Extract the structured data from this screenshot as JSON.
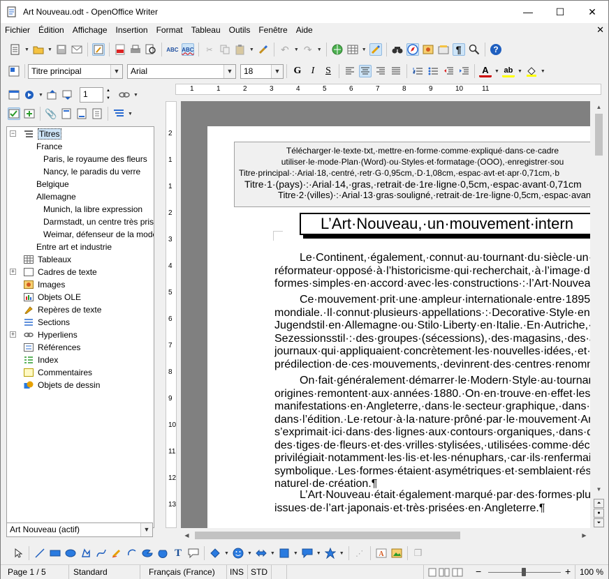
{
  "window": {
    "title": "Art Nouveau.odt - OpenOffice Writer",
    "minimize": "—",
    "maximize": "☐",
    "close": "✕"
  },
  "menu": [
    "Fichier",
    "Édition",
    "Affichage",
    "Insertion",
    "Format",
    "Tableau",
    "Outils",
    "Fenêtre",
    "Aide"
  ],
  "format_bar": {
    "style": "Titre principal",
    "font": "Arial",
    "size": "18"
  },
  "navigator": {
    "page_number": "1",
    "tree": [
      {
        "label": "Titres",
        "level": 0,
        "icon": "headings-icon",
        "selected": true
      },
      {
        "label": "France",
        "level": 1
      },
      {
        "label": "Paris, le royaume des fleurs",
        "level": 2
      },
      {
        "label": "Nancy, le paradis du verre",
        "level": 2
      },
      {
        "label": "Belgique",
        "level": 1
      },
      {
        "label": "Allemagne",
        "level": 1
      },
      {
        "label": "Munich, la libre expression",
        "level": 2
      },
      {
        "label": "Darmstadt, un centre très prisé",
        "level": 2
      },
      {
        "label": "Weimar, défenseur de la mode",
        "level": 2
      },
      {
        "label": "Entre art et industrie",
        "level": 1
      },
      {
        "label": "Tableaux",
        "level": 0,
        "icon": "table-icon"
      },
      {
        "label": "Cadres de texte",
        "level": 0,
        "icon": "frame-icon"
      },
      {
        "label": "Images",
        "level": 0,
        "icon": "image-icon"
      },
      {
        "label": "Objets OLE",
        "level": 0,
        "icon": "ole-object-icon"
      },
      {
        "label": "Repères de texte",
        "level": 0,
        "icon": "bookmark-icon"
      },
      {
        "label": "Sections",
        "level": 0,
        "icon": "section-icon"
      },
      {
        "label": "Hyperliens",
        "level": 0,
        "icon": "hyperlink-icon"
      },
      {
        "label": "Références",
        "level": 0,
        "icon": "reference-icon"
      },
      {
        "label": "Index",
        "level": 0,
        "icon": "index-icon"
      },
      {
        "label": "Commentaires",
        "level": 0,
        "icon": "comment-icon"
      },
      {
        "label": "Objets de dessin",
        "level": 0,
        "icon": "drawing-object-icon"
      }
    ],
    "document": "Art Nouveau (actif)"
  },
  "ruler": {
    "h_marks": [
      "1",
      "1",
      "2",
      "3",
      "4",
      "5",
      "6",
      "7",
      "8",
      "9",
      "10",
      "11"
    ],
    "v_marks": [
      "2",
      "1",
      "1",
      "2",
      "3",
      "4",
      "5",
      "6",
      "7",
      "8",
      "9",
      "10",
      "11",
      "12",
      "13"
    ]
  },
  "document": {
    "instructions": [
      "Télécharger·le·texte·txt,·mettre·en·forme·comme·expliqué·dans·ce·cadre",
      "utiliser·le·mode·Plan·(Word)·ou·Styles·et·formatage·(OOO),·enregistrer·sou",
      "Titre·principal·:·Arial·18,·centré,·retr·G·0,95cm,·D·1,08cm,·espac·avt·et·apr·0,71cm,·b",
      "Titre·1·(pays)·:·Arial·14,·gras,·retrait·de·1re·ligne·0,5cm,·espac·avant·0,71cm",
      "Titre·2·(villes)·:·Arial·13·gras·souligné,·retrait·de·1re·ligne·0,5cm,·espac·avan"
    ],
    "title": "L’Art·Nouveau,·un·mouvement·intern",
    "paragraphs": [
      [
        "Le·Continent,·également,·connut·au·tournant·du·siècle·un·n",
        "réformateur·opposé·à·l’historicisme·qui·recherchait,·à·l’image·de",
        "formes·simples·en·accord·avec·les·constructions·:·l’Art·Nouveau"
      ],
      [
        "Ce·mouvement·prit·une·ampleur·internationale·entre·1895·",
        "mondiale.·Il·connut·plusieurs·appellations·:·Decorative·Style·en·",
        "Jugendstil·en·Allemagne·ou·Stilo·Liberty·en·Italie.·En·Autriche,·c",
        "Sezessionsstil·:·des·groupes·(sécessions),·des·magasins,·des·a",
        "journaux·qui·appliquaient·concrètement·les·nouvelles·idées,·et·le",
        "prédilection·de·ces·mouvements,·devinrent·des·centres·renomm"
      ],
      [
        "On·fait·généralement·démarrer·le·Modern·Style·au·tournan",
        "origines·remontent·aux·années·1880.·On·en·trouve·en·effet·les·p",
        "manifestations·en·Angleterre,·dans·le·secteur·graphique,·dans·l’",
        "dans·l’édition.·Le·retour·à·la·nature·prôné·par·le·mouvement·Arts",
        "s’exprimait·ici·dans·des·lignes·aux·contours·organiques,·dans·de",
        "des·tiges·de·fleurs·et·des·vrilles·stylisées,·utilisées·comme·déco",
        "privilégiait·notamment·les·lis·et·les·nénuphars,·car·ils·renfermaie",
        "symbolique.·Les·formes·étaient·asymétriques·et·semblaient·résu",
        "naturel·de·création.¶"
      ],
      [
        "L’Art·Nouveau·était·également·marqué·par·des·formes·plut",
        "issues·de·l’art·japonais·et·très·prisées·en·Angleterre.¶"
      ]
    ]
  },
  "status": {
    "page": "Page 1 / 5",
    "style": "Standard",
    "language": "Français (France)",
    "ins": "INS",
    "std": "STD",
    "zoom": "100 %"
  }
}
